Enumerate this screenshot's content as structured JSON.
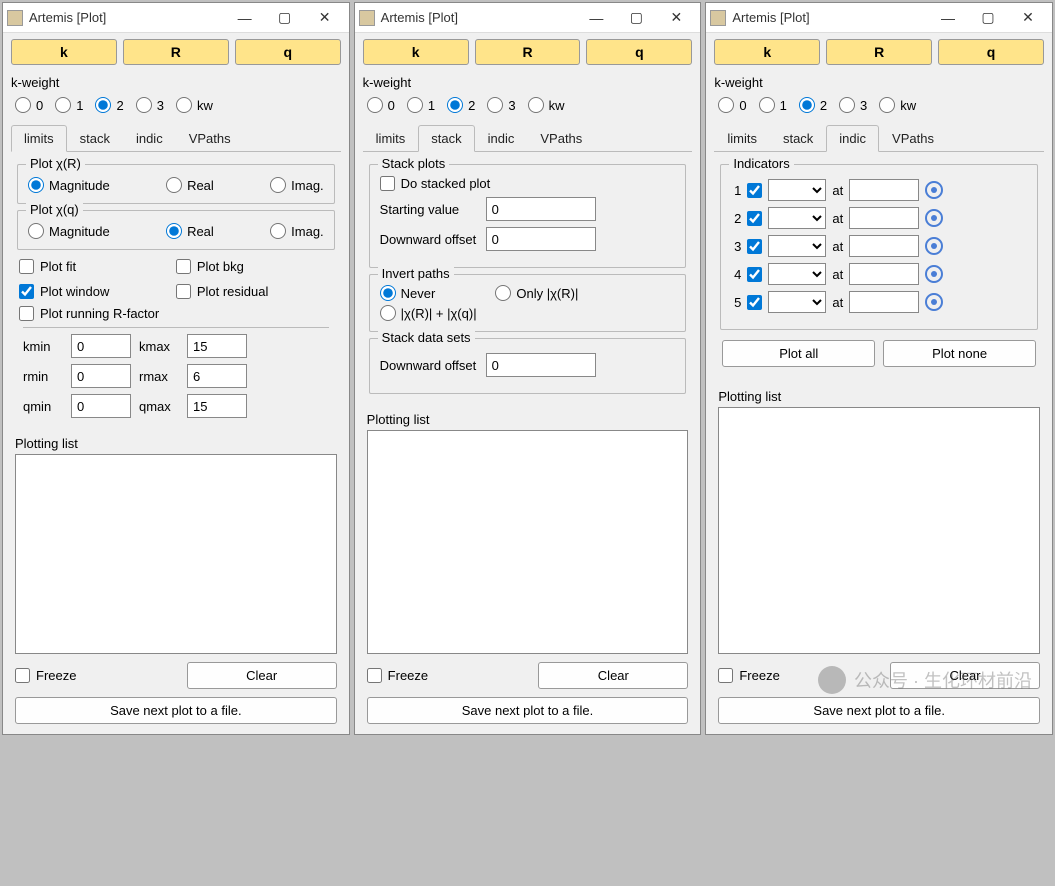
{
  "windowTitle": "Artemis [Plot]",
  "winControls": {
    "min": "—",
    "max": "▢",
    "close": "✕"
  },
  "topTabs": {
    "k": "k",
    "R": "R",
    "q": "q"
  },
  "kweight": {
    "label": "k-weight",
    "opts": {
      "0": "0",
      "1": "1",
      "2": "2",
      "3": "3",
      "kw": "kw"
    },
    "selected": "2"
  },
  "tabs": {
    "limits": "limits",
    "stack": "stack",
    "indic": "indic",
    "vpaths": "VPaths"
  },
  "limits": {
    "plotChiR": {
      "legend": "Plot χ(R)",
      "mag": "Magnitude",
      "real": "Real",
      "imag": "Imag.",
      "selected": "mag"
    },
    "plotChiQ": {
      "legend": "Plot χ(q)",
      "mag": "Magnitude",
      "real": "Real",
      "imag": "Imag.",
      "selected": "real"
    },
    "checks": {
      "plotFit": "Plot fit",
      "plotBkg": "Plot bkg",
      "plotWindow": "Plot window",
      "plotResidual": "Plot residual",
      "plotRunningR": "Plot running R-factor"
    },
    "ranges": {
      "kminLabel": "kmin",
      "kmin": "0",
      "kmaxLabel": "kmax",
      "kmax": "15",
      "rminLabel": "rmin",
      "rmin": "0",
      "rmaxLabel": "rmax",
      "rmax": "6",
      "qminLabel": "qmin",
      "qmin": "0",
      "qmaxLabel": "qmax",
      "qmax": "15"
    }
  },
  "stack": {
    "stackPlots": {
      "legend": "Stack plots",
      "doStacked": "Do stacked plot",
      "startLabel": "Starting value",
      "startVal": "0",
      "downLabel": "Downward offset",
      "downVal": "0"
    },
    "invert": {
      "legend": "Invert paths",
      "never": "Never",
      "onlyChiR": "Only |χ(R)|",
      "both": "|χ(R)| + |χ(q)|",
      "selected": "never"
    },
    "stackData": {
      "legend": "Stack data sets",
      "downLabel": "Downward offset",
      "downVal": "0"
    }
  },
  "indic": {
    "legend": "Indicators",
    "at": "at",
    "rows": [
      "1",
      "2",
      "3",
      "4",
      "5"
    ],
    "plotAll": "Plot all",
    "plotNone": "Plot none"
  },
  "plottingList": "Plotting list",
  "freeze": "Freeze",
  "clear": "Clear",
  "saveNext": "Save next plot to a file.",
  "watermark": "公众号 · 生化环材前沿"
}
